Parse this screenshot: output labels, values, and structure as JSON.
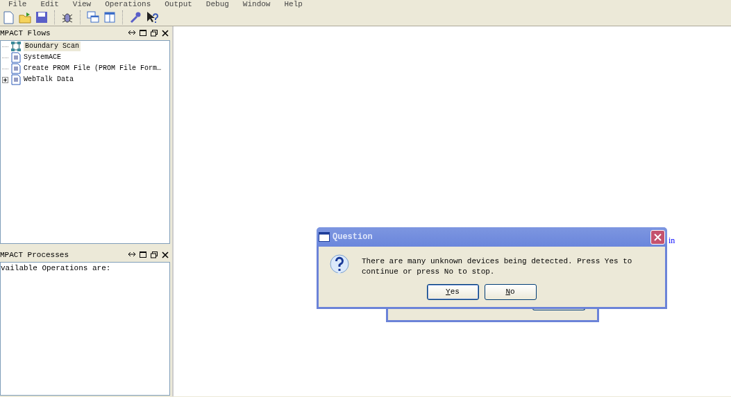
{
  "menu": [
    "File",
    "Edit",
    "View",
    "Operations",
    "Output",
    "Debug",
    "Window",
    "Help"
  ],
  "flows_panel": {
    "title": "MPACT Flows",
    "items": [
      {
        "label": "Boundary Scan",
        "kind": "chain",
        "selected": true,
        "expandable": false
      },
      {
        "label": "SystemACE",
        "kind": "doc",
        "selected": false,
        "expandable": false
      },
      {
        "label": "Create PROM File (PROM File Form…",
        "kind": "doc",
        "selected": false,
        "expandable": false
      },
      {
        "label": "WebTalk Data",
        "kind": "doc",
        "selected": false,
        "expandable": true
      }
    ]
  },
  "processes_panel": {
    "title": "MPACT Processes",
    "text": "vailable Operations are:"
  },
  "background_text": "in",
  "dialog": {
    "title": "Question",
    "message": "There are many unknown devices being detected. Press Yes to continue or press No to stop.",
    "buttons": [
      {
        "label": "Yes",
        "default": true
      },
      {
        "label": "No",
        "default": false
      }
    ]
  }
}
